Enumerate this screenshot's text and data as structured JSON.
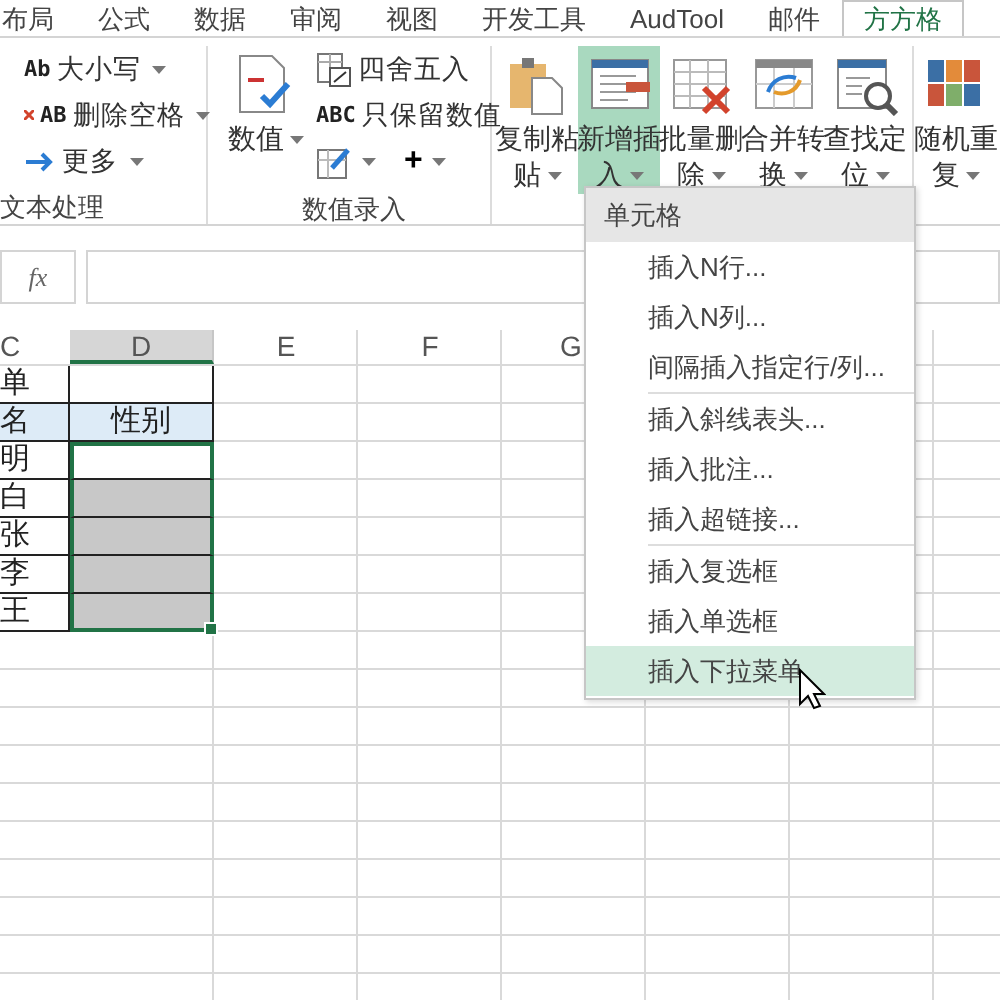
{
  "tabs": [
    {
      "label": "布局",
      "selected": false
    },
    {
      "label": "公式",
      "selected": false
    },
    {
      "label": "数据",
      "selected": false
    },
    {
      "label": "审阅",
      "selected": false
    },
    {
      "label": "视图",
      "selected": false
    },
    {
      "label": "开发工具",
      "selected": false
    },
    {
      "label": "AudTool",
      "selected": false
    },
    {
      "label": "邮件",
      "selected": false
    },
    {
      "label": "方方格",
      "selected": true
    }
  ],
  "ribbon": {
    "groups": [
      {
        "label": "文本处理",
        "items": [
          {
            "kind": "small",
            "icon_text": "Ab",
            "label": "大小写",
            "dropdown": true
          },
          {
            "kind": "small",
            "icon_text": "AB",
            "label": "删除空格",
            "dropdown": true
          },
          {
            "kind": "small",
            "label": "更多",
            "dropdown": true
          }
        ]
      },
      {
        "label": "数值录入",
        "items": [
          {
            "kind": "big",
            "label": "数值",
            "dropdown": true,
            "selected": false
          },
          {
            "kind": "small",
            "label": "四舍五入",
            "dropdown": false
          },
          {
            "kind": "small",
            "icon_text": "ABC",
            "label": "只保留数值",
            "dropdown": false
          },
          {
            "kind": "iconrow",
            "buttons": [
              {
                "dropdown": true
              },
              {
                "label": "+",
                "dropdown": true
              }
            ]
          }
        ]
      },
      {
        "items": [
          {
            "kind": "big",
            "label": "复制粘贴",
            "dropdown": true,
            "selected": false
          },
          {
            "kind": "big",
            "label": "新增插入",
            "dropdown": true,
            "selected": true
          },
          {
            "kind": "big",
            "label": "批量删除",
            "dropdown": true,
            "selected": false
          },
          {
            "kind": "big",
            "label": "合并转换",
            "dropdown": true,
            "selected": false
          },
          {
            "kind": "big",
            "label": "查找定位",
            "dropdown": true,
            "selected": false
          }
        ]
      },
      {
        "items": [
          {
            "kind": "big",
            "label": "随机重复",
            "dropdown": true,
            "selected": false
          }
        ]
      }
    ]
  },
  "formula_bar": {
    "fx": "fx"
  },
  "sheet": {
    "columns": [
      {
        "label": "C",
        "selected": false
      },
      {
        "label": "D",
        "selected": true
      },
      {
        "label": "E",
        "selected": false
      },
      {
        "label": "F",
        "selected": false
      },
      {
        "label": "G",
        "selected": false
      }
    ],
    "rows": [
      {
        "kind": "title",
        "cells": [
          {
            "text": "单",
            "selected": false,
            "shaded": false
          },
          {
            "text": "",
            "selected": false,
            "shaded": false
          }
        ]
      },
      {
        "kind": "header",
        "cells": [
          {
            "text": "名",
            "selected": false,
            "shaded": false
          },
          {
            "text": "性别",
            "selected": false,
            "shaded": false
          }
        ]
      },
      {
        "kind": "data",
        "cells": [
          {
            "text": "明",
            "selected": false,
            "shaded": false
          },
          {
            "text": "",
            "selected": true,
            "shaded": false
          }
        ]
      },
      {
        "kind": "data",
        "cells": [
          {
            "text": "白",
            "selected": false,
            "shaded": false
          },
          {
            "text": "",
            "selected": true,
            "shaded": true
          }
        ]
      },
      {
        "kind": "data",
        "cells": [
          {
            "text": "张",
            "selected": false,
            "shaded": false
          },
          {
            "text": "",
            "selected": true,
            "shaded": true
          }
        ]
      },
      {
        "kind": "data",
        "cells": [
          {
            "text": "李",
            "selected": false,
            "shaded": false
          },
          {
            "text": "",
            "selected": true,
            "shaded": true
          }
        ]
      },
      {
        "kind": "data",
        "cells": [
          {
            "text": "王",
            "selected": false,
            "shaded": false
          },
          {
            "text": "",
            "selected": true,
            "shaded": true
          }
        ]
      }
    ]
  },
  "menu": {
    "title": "单元格",
    "sections": [
      [
        {
          "label": "插入N行...",
          "selected": false
        },
        {
          "label": "插入N列...",
          "selected": false
        },
        {
          "label": "间隔插入指定行/列...",
          "selected": false
        }
      ],
      [
        {
          "label": "插入斜线表头...",
          "selected": false
        },
        {
          "label": "插入批注...",
          "selected": false
        },
        {
          "label": "插入超链接...",
          "selected": false
        }
      ],
      [
        {
          "label": "插入复选框",
          "selected": false
        },
        {
          "label": "插入单选框",
          "selected": false
        },
        {
          "label": "插入下拉菜单",
          "selected": true
        }
      ]
    ]
  }
}
